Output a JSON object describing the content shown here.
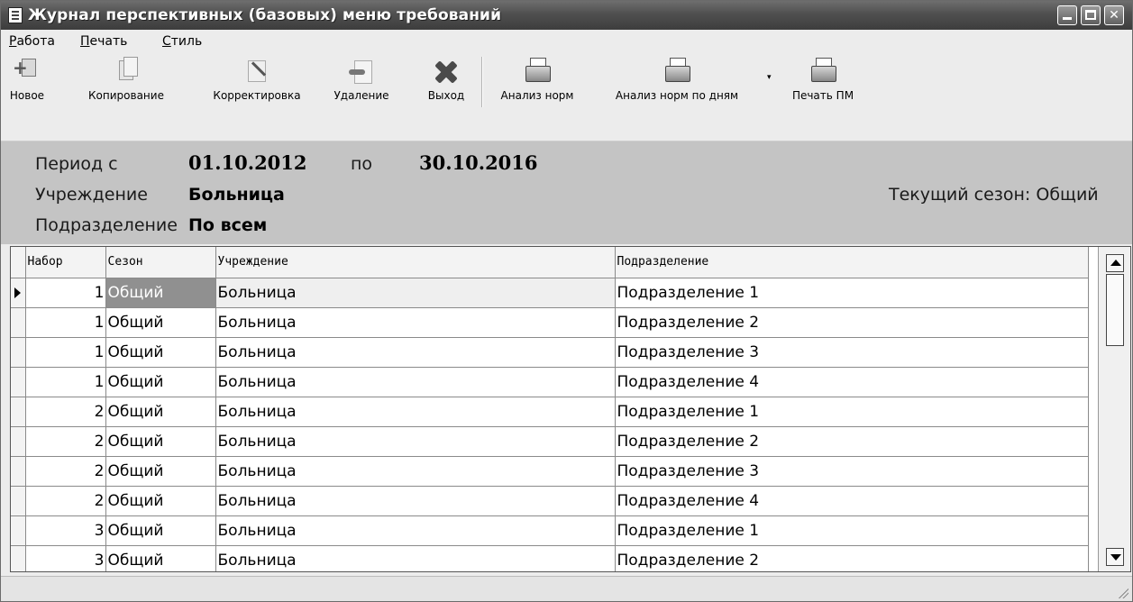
{
  "window": {
    "title": "Журнал перспективных (базовых) меню требований",
    "min_label": "",
    "max_label": "",
    "close_label": "✕"
  },
  "menu": [
    {
      "label": "Работа"
    },
    {
      "label": "Печать"
    },
    {
      "label": "Стиль"
    }
  ],
  "toolbar": {
    "new": "Новое",
    "copy": "Копирование",
    "edit": "Корректировка",
    "delete": "Удаление",
    "exit": "Выход",
    "analysis": "Анализ норм",
    "analysis_days": "Анализ норм по дням",
    "dropdown_arrow": "▾",
    "print_pm": "Печать ПМ"
  },
  "filter": {
    "period_label": "Период с",
    "period_from": "01.10.2012",
    "period_to_label": "по",
    "period_to": "30.10.2016",
    "institution_label": "Учреждение",
    "institution_value": "Больница",
    "department_label": "Подразделение",
    "department_value": "По всем",
    "season_text": "Текущий сезон: Общий"
  },
  "table": {
    "columns": [
      "Набор",
      "Сезон",
      "Учреждение",
      "Подразделение"
    ],
    "rows": [
      {
        "nabor": "1",
        "sezon": "Общий",
        "uchrezhdenie": "Больница",
        "podrazdelenie": "Подразделение 1"
      },
      {
        "nabor": "1",
        "sezon": "Общий",
        "uchrezhdenie": "Больница",
        "podrazdelenie": "Подразделение 2"
      },
      {
        "nabor": "1",
        "sezon": "Общий",
        "uchrezhdenie": "Больница",
        "podrazdelenie": "Подразделение 3"
      },
      {
        "nabor": "1",
        "sezon": "Общий",
        "uchrezhdenie": "Больница",
        "podrazdelenie": "Подразделение 4"
      },
      {
        "nabor": "2",
        "sezon": "Общий",
        "uchrezhdenie": "Больница",
        "podrazdelenie": "Подразделение 1"
      },
      {
        "nabor": "2",
        "sezon": "Общий",
        "uchrezhdenie": "Больница",
        "podrazdelenie": "Подразделение 2"
      },
      {
        "nabor": "2",
        "sezon": "Общий",
        "uchrezhdenie": "Больница",
        "podrazdelenie": "Подразделение 3"
      },
      {
        "nabor": "2",
        "sezon": "Общий",
        "uchrezhdenie": "Больница",
        "podrazdelenie": "Подразделение 4"
      },
      {
        "nabor": "3",
        "sezon": "Общий",
        "uchrezhdenie": "Больница",
        "podrazdelenie": "Подразделение 1"
      },
      {
        "nabor": "3",
        "sezon": "Общий",
        "uchrezhdenie": "Больница",
        "podrazdelenie": "Подразделение 2"
      }
    ]
  },
  "colors": {
    "titlebar": "#4f4f4f",
    "info_panel": "#c4c4c4",
    "selected_cell": "#909090"
  },
  "icons": [
    "document-window-icon",
    "new-icon",
    "copy-icon",
    "edit-icon",
    "delete-icon",
    "exit-icon",
    "printer-icon"
  ]
}
